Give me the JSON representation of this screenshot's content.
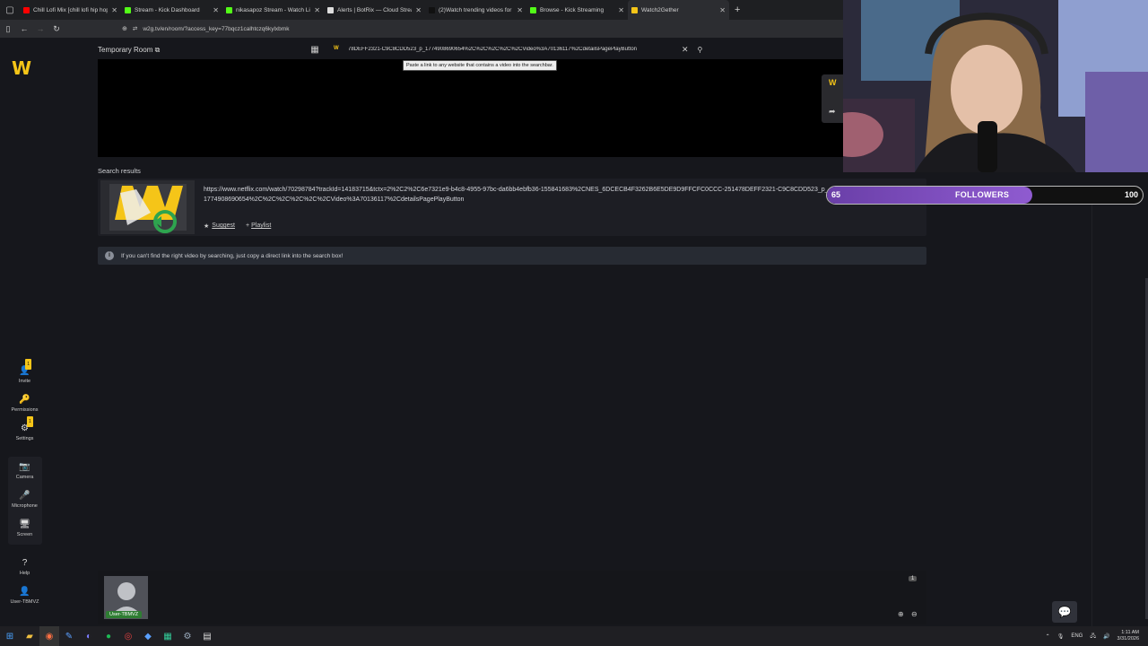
{
  "browser": {
    "tabs": [
      {
        "label": "Chill Lofi Mix [chill lofi hip hop",
        "color": "#ff0000",
        "active": false
      },
      {
        "label": "Stream - Kick Dashboard",
        "color": "#53fc18",
        "active": false
      },
      {
        "label": "nikasapoz Stream - Watch Live",
        "color": "#53fc18",
        "active": false
      },
      {
        "label": "Alerts | BotRix — Cloud Stream",
        "color": "#dddddd",
        "active": false
      },
      {
        "label": "(2)Watch trending videos for y",
        "color": "#111111",
        "active": false
      },
      {
        "label": "Browse - Kick Streaming",
        "color": "#53fc18",
        "active": false
      },
      {
        "label": "Watch2Gether",
        "color": "#f5c518",
        "active": true
      }
    ],
    "url": "w2g.tv/en/room/?access_key=77bqcz1calhtczq6kylxbmk"
  },
  "sidebar": {
    "logo": "W",
    "items": [
      {
        "label": "Invite",
        "icon": "add-user-icon",
        "glyph": "👤",
        "badge": "1"
      },
      {
        "label": "Permissions",
        "icon": "permissions-icon",
        "glyph": "🔑",
        "badge": ""
      },
      {
        "label": "Settings",
        "icon": "gear-icon",
        "glyph": "⚙",
        "badge": "1"
      },
      {
        "label": "Camera",
        "icon": "camera-icon",
        "glyph": "📷",
        "badge": ""
      },
      {
        "label": "Microphone",
        "icon": "microphone-icon",
        "glyph": "🎤",
        "badge": ""
      },
      {
        "label": "Screen",
        "icon": "screen-icon",
        "glyph": "🖥",
        "badge": ""
      },
      {
        "label": "Help",
        "icon": "help-icon",
        "glyph": "?",
        "badge": ""
      },
      {
        "label": "User-TBMVZ",
        "icon": "user-icon",
        "glyph": "👤",
        "badge": ""
      }
    ]
  },
  "room": {
    "title": "Temporary Room",
    "search_value": "78DEFF2321-C9C8CDD523_p_1774908690654%2C%2C%2C%2C%2CVideo%3A70136117%2CdetailsPagePlayButton",
    "search_favicon": "W",
    "tooltip": "Paste a link to any website that contains a video into the searchbar."
  },
  "results": {
    "title": "Search results",
    "items": [
      {
        "url": "https://www.netflix.com/watch/70298784?trackId=14183715&tctx=2%2C2%2C6e7321e9-b4c8-4955-97bc-da6bb4ebfb36-155841683%2CNES_6DCECB4F3262B6E5DE9D9FFCFC0CCC-251478DEFF2321-C9C8CDD523_p_1774908690654%2C%2C%2C%2C%2C%2CVideo%3A70136117%2CdetailsPagePlayButton",
        "suggest_label": "Suggest",
        "playlist_label": "Playlist"
      }
    ]
  },
  "info": {
    "text": "If you can't find the right video by searching, just copy a direct link into the search box!"
  },
  "followers": {
    "current": "65",
    "label": "FOLLOWERS",
    "goal": "100",
    "progress": 0.65
  },
  "users": {
    "name": "User-TBMVZ",
    "count": "1"
  },
  "taskbar": {
    "language": "ENG",
    "time": "1:11 AM",
    "date": "3/31/2026"
  }
}
